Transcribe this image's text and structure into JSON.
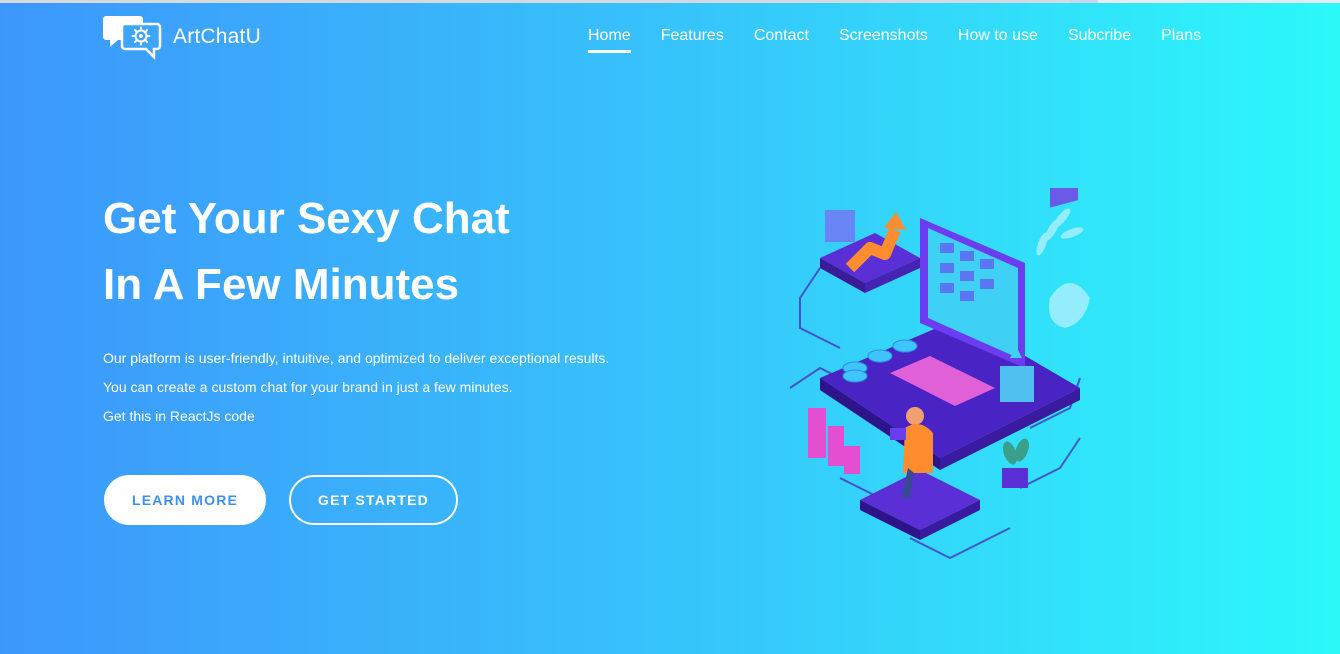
{
  "brand": {
    "name": "ArtChatU",
    "logo_icon": "chat-gear-icon"
  },
  "nav": {
    "items": [
      {
        "label": "Home",
        "active": true
      },
      {
        "label": "Features",
        "active": false
      },
      {
        "label": "Contact",
        "active": false
      },
      {
        "label": "Screenshots",
        "active": false
      },
      {
        "label": "How to use",
        "active": false
      },
      {
        "label": "Subcribe",
        "active": false
      },
      {
        "label": "Plans",
        "active": false
      }
    ]
  },
  "hero": {
    "title_line1": "Get Your Sexy Chat",
    "title_line2": "In A Few Minutes",
    "desc_line1": "Our platform is user-friendly, intuitive, and optimized to deliver exceptional results.",
    "desc_line2": "You can create a custom chat for your brand in just a few minutes.",
    "desc_line3": "Get this in ReactJs code",
    "learn_more": "LEARN MORE",
    "get_started": "GET STARTED"
  },
  "colors": {
    "gradient_start": "#3d97fb",
    "gradient_end": "#2cf8fa",
    "button_text": "#3f91f0",
    "illustration_primary": "#5b2fd6",
    "illustration_accent": "#e34fd0"
  }
}
